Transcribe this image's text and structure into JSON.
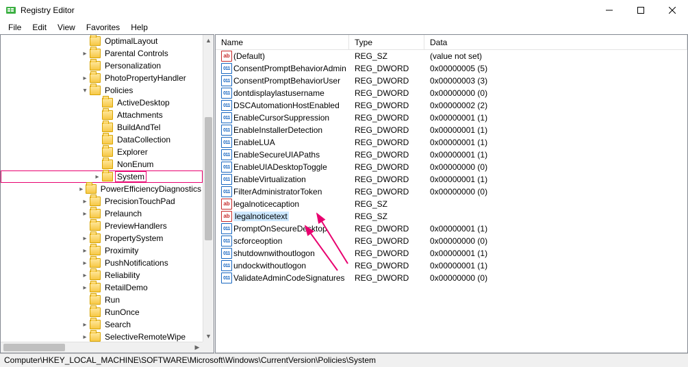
{
  "window": {
    "title": "Registry Editor"
  },
  "menu": [
    "File",
    "Edit",
    "View",
    "Favorites",
    "Help"
  ],
  "tree_base_indent": 116,
  "tree": [
    {
      "label": "OptimalLayout",
      "depth": 0,
      "twisty": ""
    },
    {
      "label": "Parental Controls",
      "depth": 0,
      "twisty": ">"
    },
    {
      "label": "Personalization",
      "depth": 0,
      "twisty": ""
    },
    {
      "label": "PhotoPropertyHandler",
      "depth": 0,
      "twisty": ">"
    },
    {
      "label": "Policies",
      "depth": 0,
      "twisty": "v"
    },
    {
      "label": "ActiveDesktop",
      "depth": 1,
      "twisty": ""
    },
    {
      "label": "Attachments",
      "depth": 1,
      "twisty": ""
    },
    {
      "label": "BuildAndTel",
      "depth": 1,
      "twisty": ""
    },
    {
      "label": "DataCollection",
      "depth": 1,
      "twisty": ""
    },
    {
      "label": "Explorer",
      "depth": 1,
      "twisty": ""
    },
    {
      "label": "NonEnum",
      "depth": 1,
      "twisty": ""
    },
    {
      "label": "System",
      "depth": 1,
      "twisty": ">",
      "hl": true
    },
    {
      "label": "PowerEfficiencyDiagnostics",
      "depth": 0,
      "twisty": ">"
    },
    {
      "label": "PrecisionTouchPad",
      "depth": 0,
      "twisty": ">"
    },
    {
      "label": "Prelaunch",
      "depth": 0,
      "twisty": ">"
    },
    {
      "label": "PreviewHandlers",
      "depth": 0,
      "twisty": ""
    },
    {
      "label": "PropertySystem",
      "depth": 0,
      "twisty": ">"
    },
    {
      "label": "Proximity",
      "depth": 0,
      "twisty": ">"
    },
    {
      "label": "PushNotifications",
      "depth": 0,
      "twisty": ">"
    },
    {
      "label": "Reliability",
      "depth": 0,
      "twisty": ">"
    },
    {
      "label": "RetailDemo",
      "depth": 0,
      "twisty": ">"
    },
    {
      "label": "Run",
      "depth": 0,
      "twisty": ""
    },
    {
      "label": "RunOnce",
      "depth": 0,
      "twisty": ""
    },
    {
      "label": "Search",
      "depth": 0,
      "twisty": ">"
    },
    {
      "label": "SelectiveRemoteWipe",
      "depth": 0,
      "twisty": ">"
    }
  ],
  "list_headers": {
    "name": "Name",
    "type": "Type",
    "data": "Data"
  },
  "values": [
    {
      "icon": "sz",
      "name": "(Default)",
      "type": "REG_SZ",
      "data": "(value not set)"
    },
    {
      "icon": "dw",
      "name": "ConsentPromptBehaviorAdmin",
      "type": "REG_DWORD",
      "data": "0x00000005 (5)"
    },
    {
      "icon": "dw",
      "name": "ConsentPromptBehaviorUser",
      "type": "REG_DWORD",
      "data": "0x00000003 (3)"
    },
    {
      "icon": "dw",
      "name": "dontdisplaylastusername",
      "type": "REG_DWORD",
      "data": "0x00000000 (0)"
    },
    {
      "icon": "dw",
      "name": "DSCAutomationHostEnabled",
      "type": "REG_DWORD",
      "data": "0x00000002 (2)"
    },
    {
      "icon": "dw",
      "name": "EnableCursorSuppression",
      "type": "REG_DWORD",
      "data": "0x00000001 (1)"
    },
    {
      "icon": "dw",
      "name": "EnableInstallerDetection",
      "type": "REG_DWORD",
      "data": "0x00000001 (1)"
    },
    {
      "icon": "dw",
      "name": "EnableLUA",
      "type": "REG_DWORD",
      "data": "0x00000001 (1)"
    },
    {
      "icon": "dw",
      "name": "EnableSecureUIAPaths",
      "type": "REG_DWORD",
      "data": "0x00000001 (1)"
    },
    {
      "icon": "dw",
      "name": "EnableUIADesktopToggle",
      "type": "REG_DWORD",
      "data": "0x00000000 (0)"
    },
    {
      "icon": "dw",
      "name": "EnableVirtualization",
      "type": "REG_DWORD",
      "data": "0x00000001 (1)"
    },
    {
      "icon": "dw",
      "name": "FilterAdministratorToken",
      "type": "REG_DWORD",
      "data": "0x00000000 (0)"
    },
    {
      "icon": "sz",
      "name": "legalnoticecaption",
      "type": "REG_SZ",
      "data": ""
    },
    {
      "icon": "sz",
      "name": "legalnoticetext",
      "type": "REG_SZ",
      "data": "",
      "sel": true
    },
    {
      "icon": "dw",
      "name": "PromptOnSecureDesktop",
      "type": "REG_DWORD",
      "data": "0x00000001 (1)"
    },
    {
      "icon": "dw",
      "name": "scforceoption",
      "type": "REG_DWORD",
      "data": "0x00000000 (0)"
    },
    {
      "icon": "dw",
      "name": "shutdownwithoutlogon",
      "type": "REG_DWORD",
      "data": "0x00000001 (1)"
    },
    {
      "icon": "dw",
      "name": "undockwithoutlogon",
      "type": "REG_DWORD",
      "data": "0x00000001 (1)"
    },
    {
      "icon": "dw",
      "name": "ValidateAdminCodeSignatures",
      "type": "REG_DWORD",
      "data": "0x00000000 (0)"
    }
  ],
  "statusbar": "Computer\\HKEY_LOCAL_MACHINE\\SOFTWARE\\Microsoft\\Windows\\CurrentVersion\\Policies\\System",
  "annotation_color": "#e8006f"
}
